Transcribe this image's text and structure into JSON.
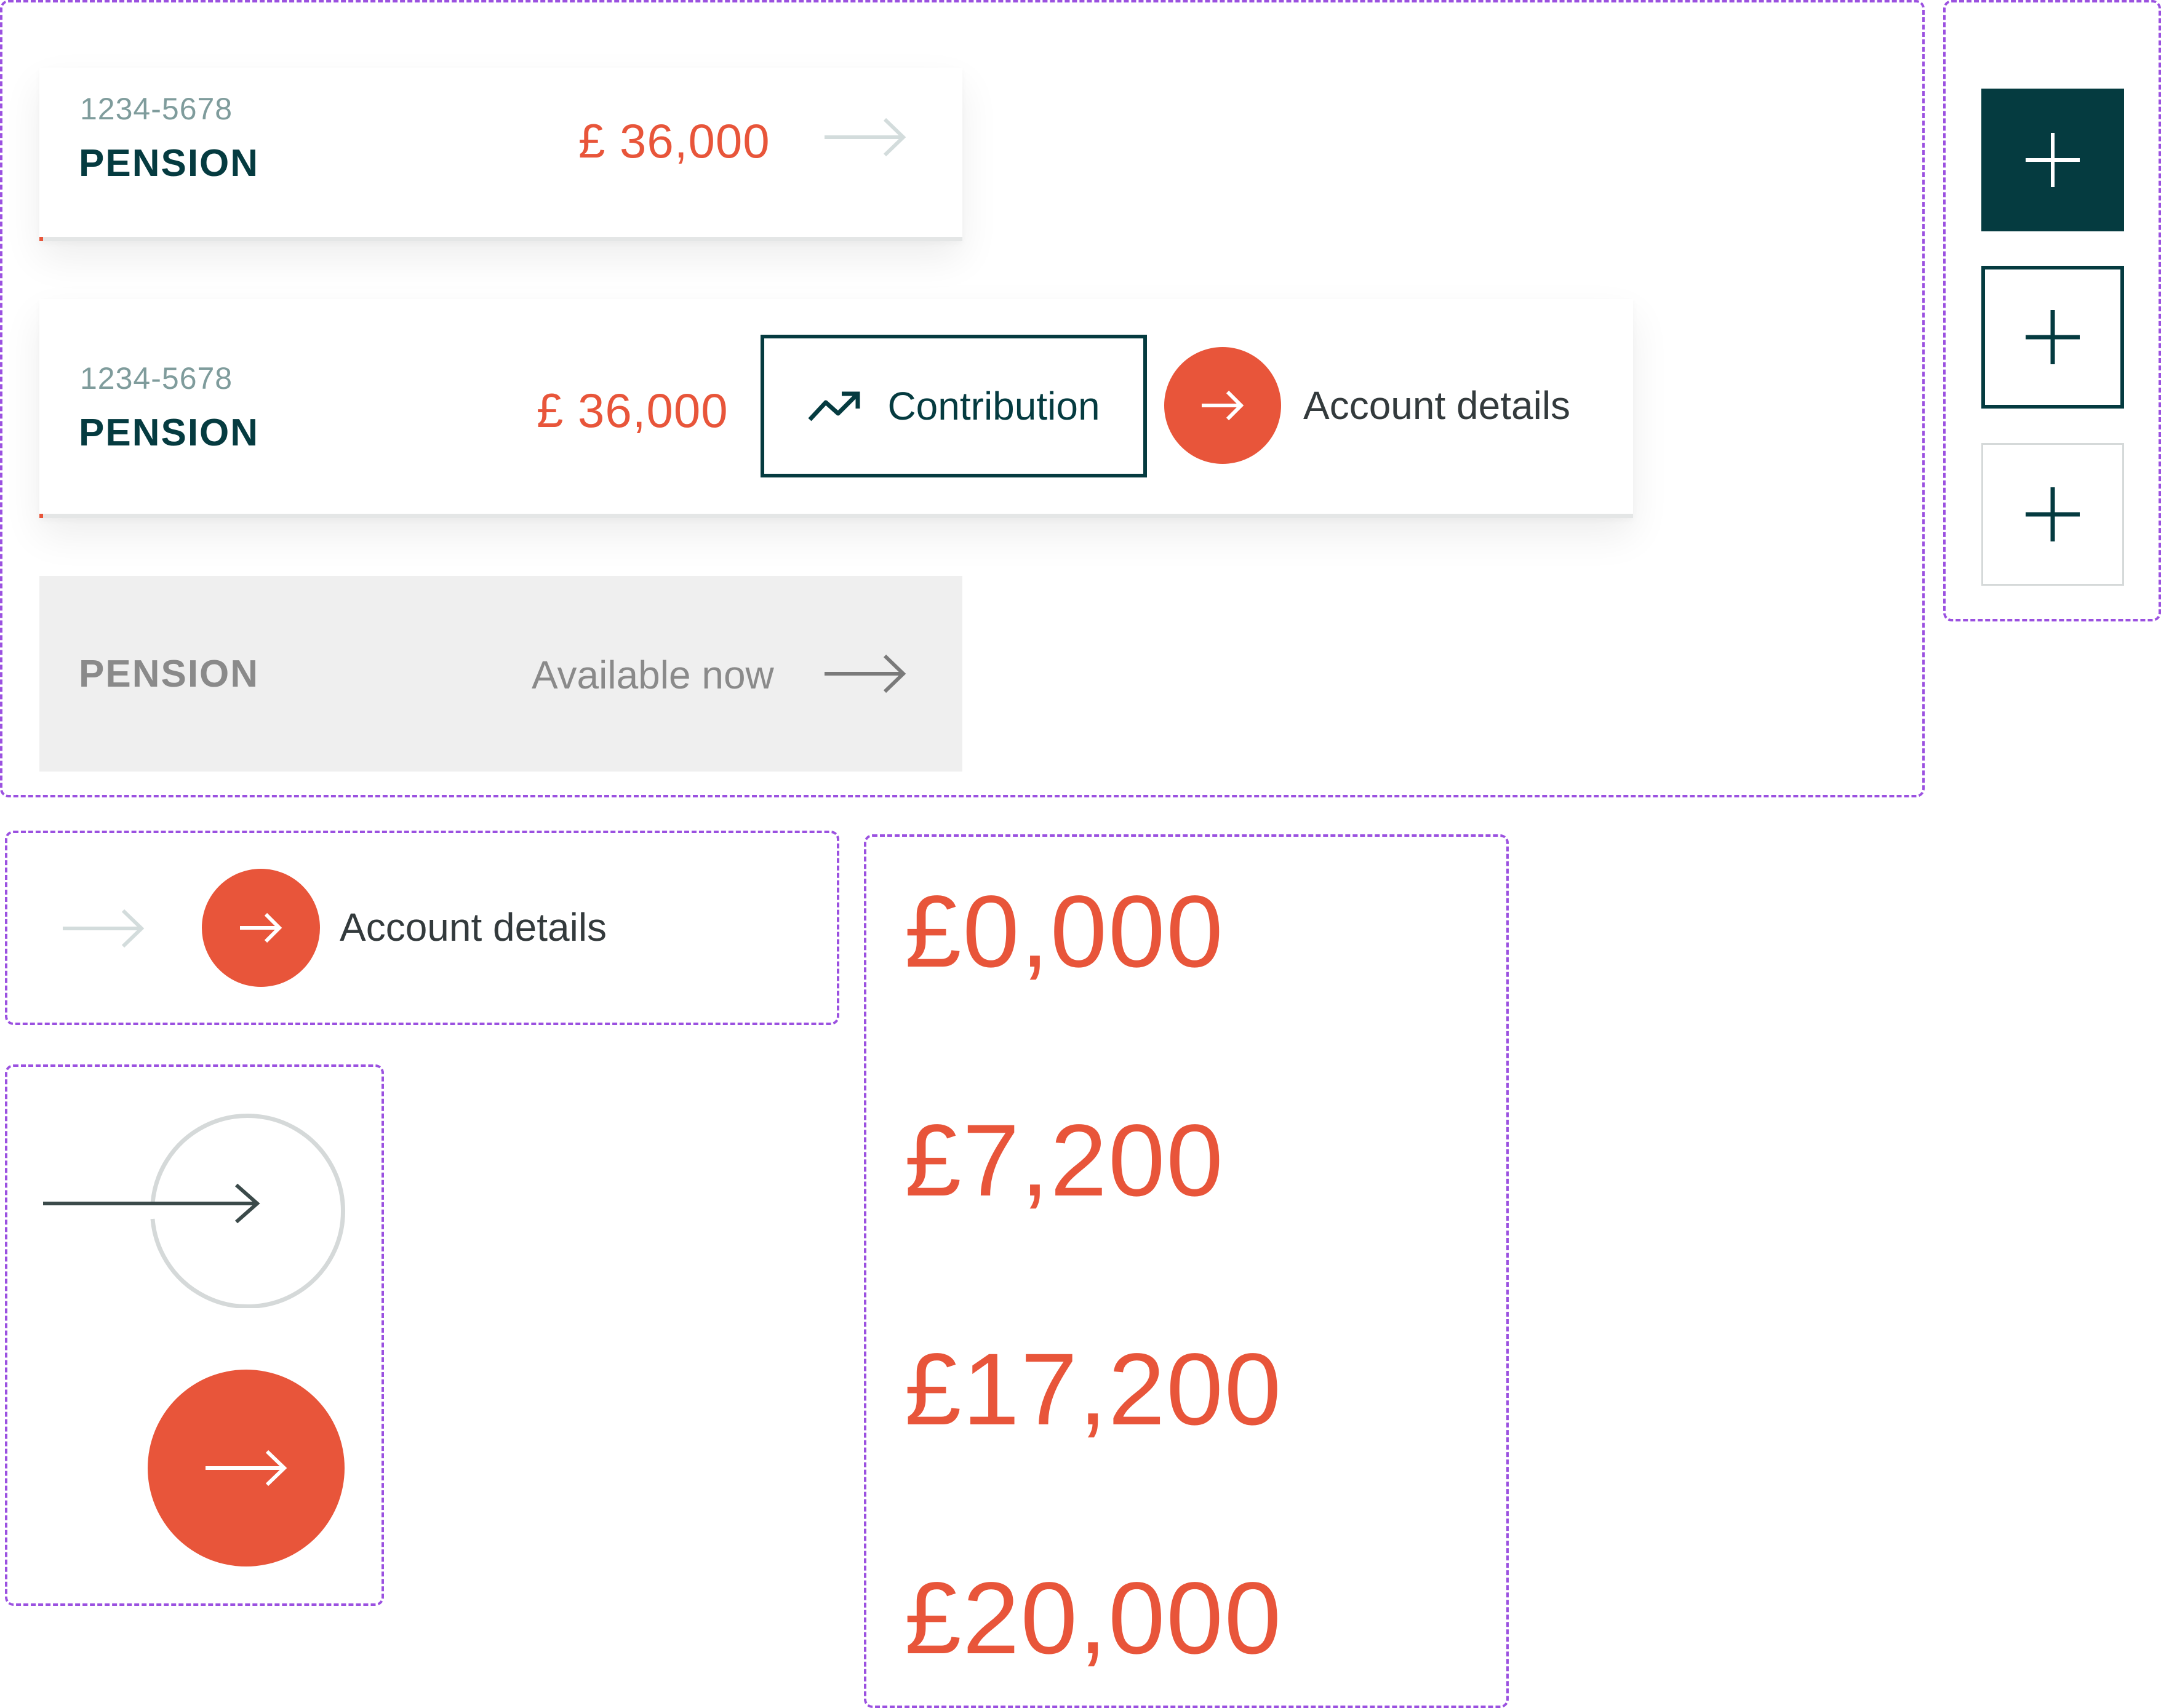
{
  "colors": {
    "accent": "#e8553a",
    "dark_teal": "#053b40",
    "frame": "#9b51e0",
    "muted": "#7f9c9c",
    "disabled_bg": "#efefef"
  },
  "card_compact": {
    "account_number": "1234-5678",
    "name": "PENSION",
    "amount": "£ 36,000",
    "arrow_icon": "arrow-right-icon"
  },
  "card_expanded": {
    "account_number": "1234-5678",
    "name": "PENSION",
    "amount": "£ 36,000",
    "contribution_label": "Contribution",
    "contribution_icon": "trending-up-icon",
    "details_label": "Account details",
    "details_icon": "arrow-right-icon"
  },
  "card_disabled": {
    "name": "PENSION",
    "status": "Available now",
    "arrow_icon": "arrow-right-icon"
  },
  "plus_buttons": [
    {
      "variant": "filled",
      "icon": "plus-icon"
    },
    {
      "variant": "outlined",
      "icon": "plus-icon"
    },
    {
      "variant": "light",
      "icon": "plus-icon"
    }
  ],
  "link_states": {
    "details_label": "Account details"
  },
  "amount_samples": [
    "£0,000",
    "£7,200",
    "£17,200",
    "£20,000"
  ]
}
